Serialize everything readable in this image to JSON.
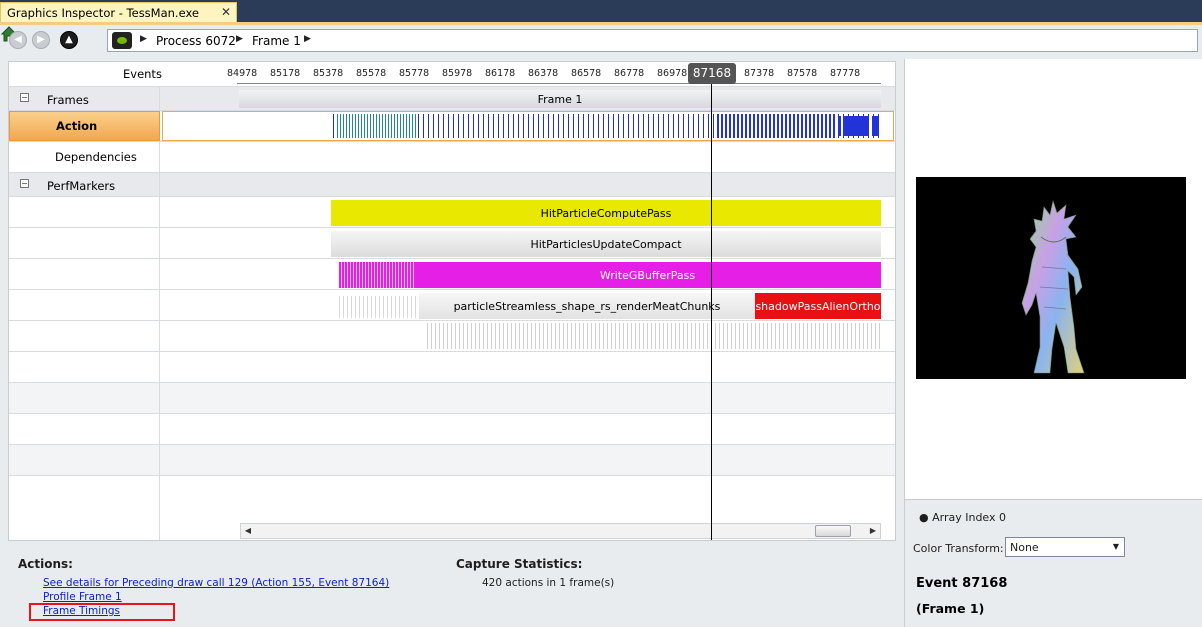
{
  "tab": {
    "title": "Graphics Inspector - TessMan.exe",
    "close": "✕"
  },
  "breadcrumb": {
    "items": [
      "Process 6072",
      "Frame 1"
    ]
  },
  "timeline": {
    "events_label": "Events",
    "ticks": [
      "84978",
      "85178",
      "85378",
      "85578",
      "85778",
      "85978",
      "86178",
      "86378",
      "86578",
      "86778",
      "86978",
      "87378",
      "87578",
      "87778"
    ],
    "cursor_event": "87168",
    "rows": {
      "frames_group": "Frames",
      "action": "Action",
      "dependencies": "Dependencies",
      "perfmarkers_group": "PerfMarkers"
    },
    "bars": {
      "frame1": "Frame 1",
      "hit_compute": "HitParticleComputePass",
      "hit_update": "HitParticlesUpdateCompact",
      "write_gbuffer": "WriteGBufferPass",
      "particle_stream": "particleStreamless_shape_rs_renderMeatChunks",
      "shadow_pass": "shadowPassAlienOrtho"
    },
    "expander_symbol": "−"
  },
  "preview": {
    "array_index": "Array Index 0",
    "color_transform_label": "Color Transform:",
    "color_transform_value": "None",
    "event": "Event 87168",
    "frame": "(Frame 1)"
  },
  "actions": {
    "title": "Actions:",
    "links": [
      "See details for Preceding draw call 129 (Action 155, Event 87164)",
      "Profile Frame 1",
      "Frame Timings"
    ]
  },
  "capture": {
    "title": "Capture Statistics:",
    "stat": "420 actions in 1 frame(s)"
  },
  "colors": {
    "accent_orange": "#f2a752",
    "hit_compute": "#e8e800",
    "write_gbuffer": "#e51fe5",
    "shadow_pass": "#e81010",
    "action_marks": "#1d2fc4",
    "highlight_box": "#e8141c"
  }
}
